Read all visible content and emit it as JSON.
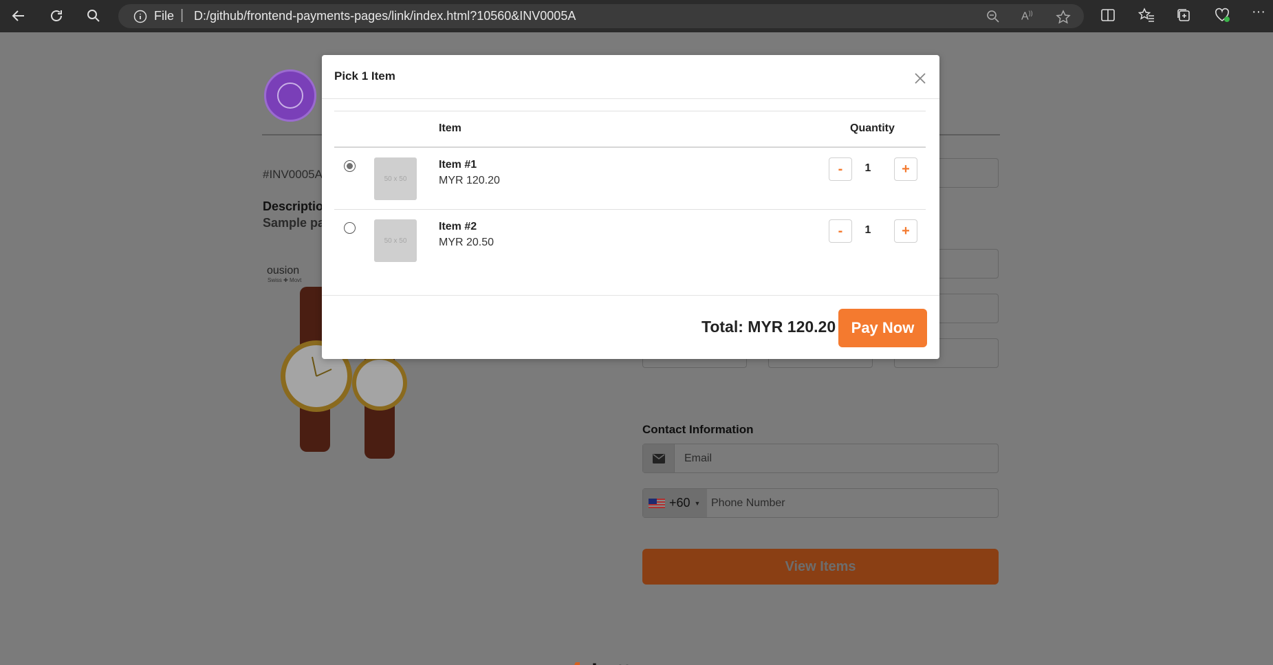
{
  "browser": {
    "addr_scheme": "File",
    "url": "D:/github/frontend-payments-pages/link/index.html?10560&INV0005A"
  },
  "page": {
    "invoice_no": "#INV0005A",
    "description_label": "Description",
    "description_value": "Sample pa",
    "product_brand": "ousion",
    "product_brand_sub": "Swiss ✚ Movt",
    "contact_label": "Contact Information",
    "email_placeholder": "Email",
    "phone_code": "+60",
    "phone_placeholder": "Phone Number",
    "view_items_label": "View Items",
    "footer_brand": "betterpay"
  },
  "modal": {
    "title": "Pick 1 Item",
    "col_item": "Item",
    "col_quantity": "Quantity",
    "items": [
      {
        "name": "Item #1",
        "price": "MYR 120.20",
        "thumb": "50 x 50",
        "qty": "1",
        "selected": true
      },
      {
        "name": "Item #2",
        "price": "MYR 20.50",
        "thumb": "50 x 50",
        "qty": "1",
        "selected": false
      }
    ],
    "minus": "-",
    "plus": "+",
    "total": "Total: MYR 120.20",
    "pay_label": "Pay Now"
  },
  "colors": {
    "accent": "#f47a2f",
    "overlay_bg": "#7b7b7b",
    "browser_bar": "#2b2b2b"
  }
}
